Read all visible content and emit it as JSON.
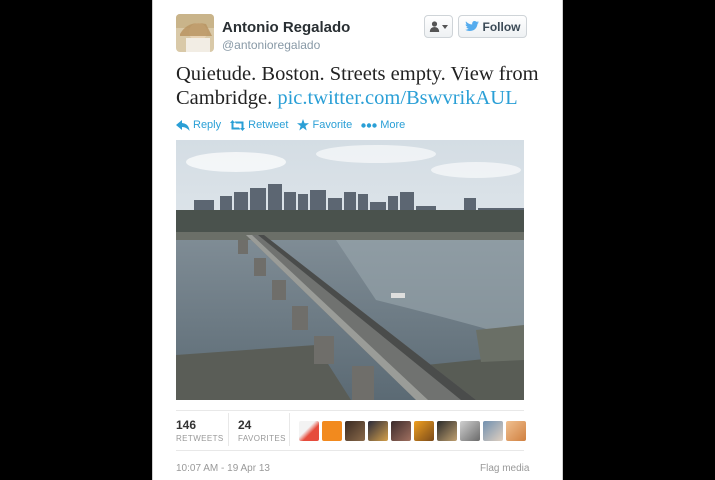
{
  "author": {
    "name": "Antonio Regalado",
    "handle": "@antonioregalado"
  },
  "header": {
    "follow_label": "Follow"
  },
  "tweet": {
    "text": "Quietude. Boston. Streets empty. View from Cambridge.",
    "link": "pic.twitter.com/BswvrikAUL"
  },
  "actions": [
    {
      "label": "Reply",
      "icon": "reply-icon"
    },
    {
      "label": "Retweet",
      "icon": "retweet-icon"
    },
    {
      "label": "Favorite",
      "icon": "star-icon"
    },
    {
      "label": "More",
      "icon": "ellipsis-icon"
    }
  ],
  "stats": {
    "retweets_count": "146",
    "retweets_label": "RETWEETS",
    "favorites_count": "24",
    "favorites_label": "FAVORITES"
  },
  "footer": {
    "timestamp": "10:07 AM - 19 Apr 13",
    "flag_media": "Flag media"
  },
  "colors": {
    "link": "#2a9fd6",
    "twitter_bird": "#55acee",
    "background": "#000000",
    "card": "#ffffff"
  }
}
